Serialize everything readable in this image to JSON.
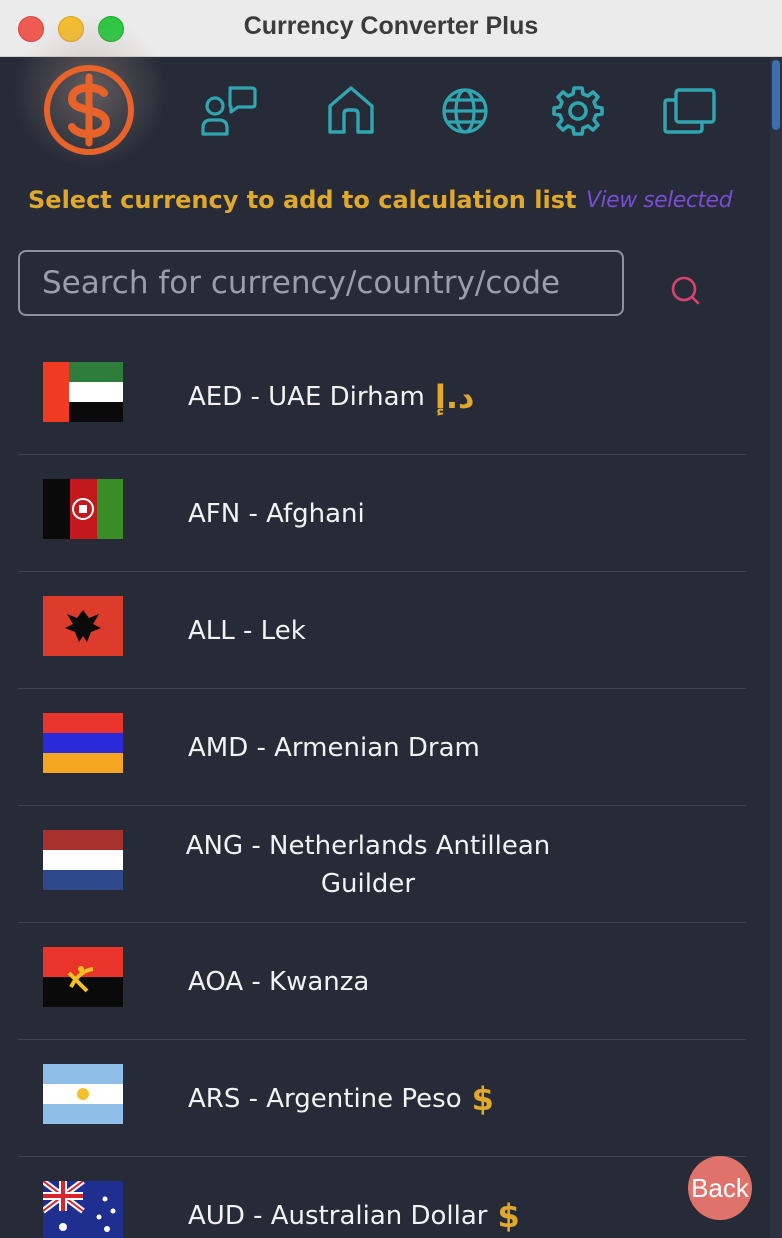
{
  "window": {
    "title": "Currency Converter Plus"
  },
  "nav": {
    "items": [
      {
        "name": "logo",
        "icon": "dollar-coin-logo-icon"
      },
      {
        "name": "chat",
        "icon": "chat-user-icon"
      },
      {
        "name": "home",
        "icon": "home-icon"
      },
      {
        "name": "globe",
        "icon": "globe-icon"
      },
      {
        "name": "settings",
        "icon": "gear-icon"
      },
      {
        "name": "windows",
        "icon": "copy-windows-icon"
      }
    ]
  },
  "heading": "Select currency to add to calculation list",
  "view_selected": "View selected",
  "search": {
    "placeholder": "Search for currency/country/code",
    "value": ""
  },
  "currencies": [
    {
      "label": "AED - UAE Dirham",
      "symbol": "د.إ",
      "flag": "ae"
    },
    {
      "label": "AFN - Afghani",
      "symbol": "",
      "flag": "af"
    },
    {
      "label": "ALL - Lek",
      "symbol": "",
      "flag": "al"
    },
    {
      "label": "AMD - Armenian Dram",
      "symbol": "",
      "flag": "am"
    },
    {
      "label": "ANG - Netherlands Antillean Guilder",
      "symbol": "",
      "flag": "nl"
    },
    {
      "label": "AOA - Kwanza",
      "symbol": "",
      "flag": "ao"
    },
    {
      "label": "ARS - Argentine Peso",
      "symbol": "$",
      "flag": "ar"
    },
    {
      "label": "AUD - Australian Dollar",
      "symbol": "$",
      "flag": "au"
    }
  ],
  "back_label": "Back",
  "colors": {
    "accent": "#e0a92b",
    "icon": "#2fa6b0",
    "logo": "#e8632a",
    "link": "#7a4ad8",
    "back": "#e0726c",
    "search_icon": "#d64373"
  }
}
